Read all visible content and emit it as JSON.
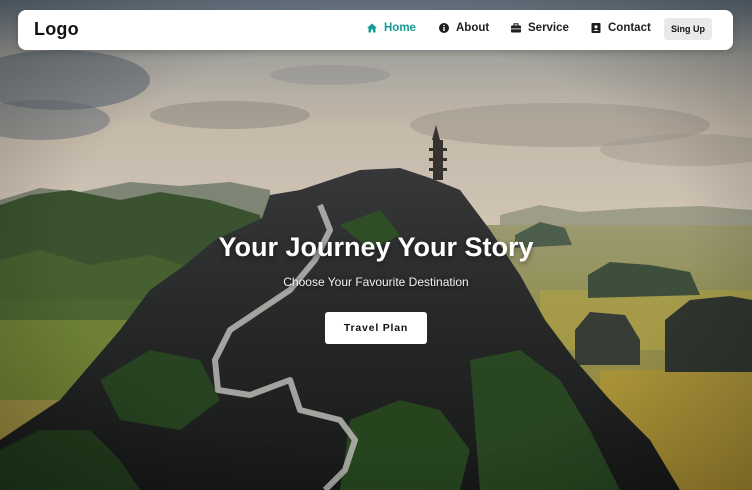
{
  "navbar": {
    "logo": "Logo",
    "items": [
      {
        "label": "Home",
        "icon": "home-icon",
        "active": true
      },
      {
        "label": "About",
        "icon": "info-icon",
        "active": false
      },
      {
        "label": "Service",
        "icon": "briefcase-icon",
        "active": false
      },
      {
        "label": "Contact",
        "icon": "contact-card-icon",
        "active": false
      }
    ],
    "signup_label": "Sing Up"
  },
  "hero": {
    "title": "Your Journey Your Story",
    "subtitle": "Choose Your Favourite Destination",
    "cta_label": "Travel Plan"
  },
  "colors": {
    "accent": "#169a95",
    "nav_bg": "#ffffff",
    "signup_bg": "#e9e9e9"
  }
}
